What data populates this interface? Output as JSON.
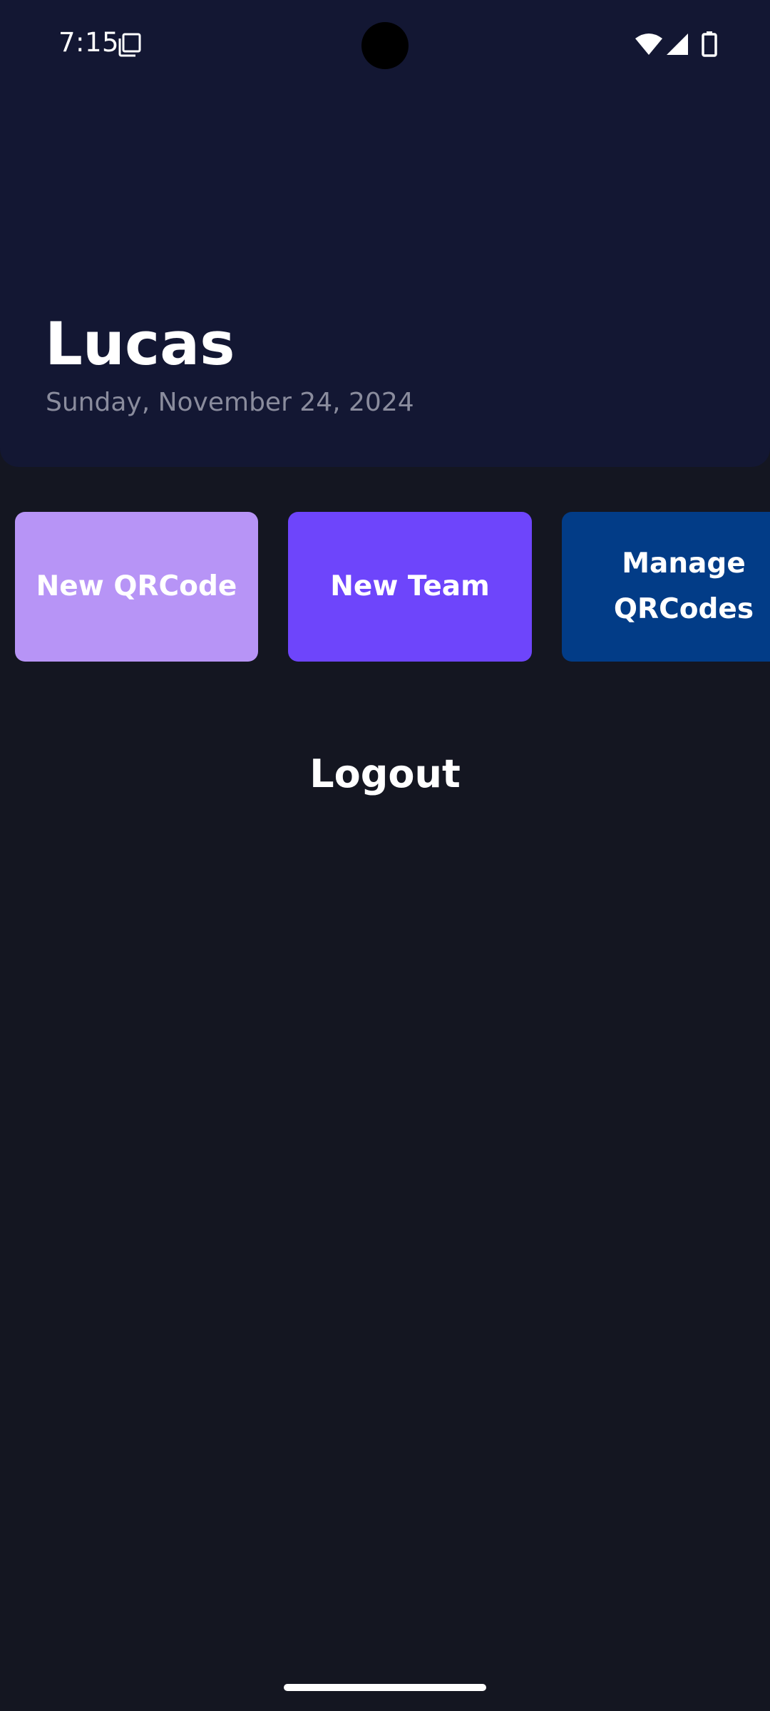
{
  "status_bar": {
    "time": "7:15",
    "icons": [
      "notification-icon",
      "wifi-icon",
      "signal-icon",
      "battery-icon"
    ]
  },
  "header": {
    "user_name": "Lucas",
    "date": "Sunday, November 24, 2024"
  },
  "actions": [
    {
      "label": "New QRCode",
      "color": "#b794f6"
    },
    {
      "label": "New Team",
      "color": "#6e45fb"
    },
    {
      "label": "Manage QRCodes",
      "color": "#023c87"
    }
  ],
  "logout": {
    "label": "Logout"
  },
  "colors": {
    "background": "#141621",
    "header_background": "#131733",
    "date_text": "#8a8c9d"
  }
}
